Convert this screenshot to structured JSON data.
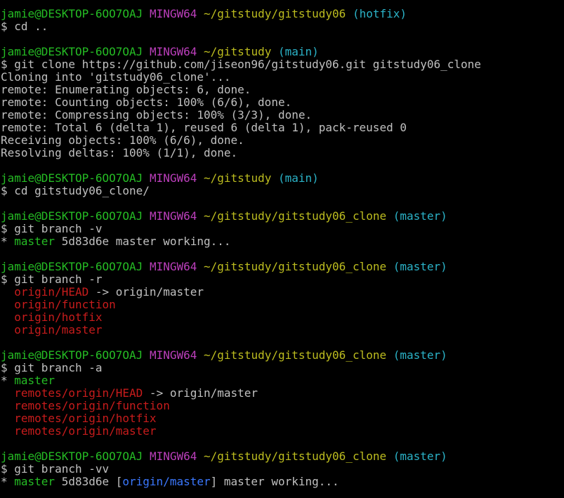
{
  "colors": {
    "background": "#000000",
    "prompt_user": "#25bc24",
    "prompt_system": "#bc3fbc",
    "prompt_path": "#bcbc1f",
    "prompt_branch": "#2bb3c8",
    "output_text": "#c0c0c0",
    "branch_current": "#25bc24",
    "branch_remote": "#c81c1c",
    "branch_upstream": "#3b78ff"
  },
  "lines": [
    [
      {
        "t": "jamie@DESKTOP-6OO7OAJ",
        "c": "user"
      },
      {
        "t": " ",
        "c": "white"
      },
      {
        "t": "MINGW64",
        "c": "mingw"
      },
      {
        "t": " ",
        "c": "white"
      },
      {
        "t": "~/gitstudy/gitstudy06",
        "c": "path"
      },
      {
        "t": " ",
        "c": "white"
      },
      {
        "t": "(hotfix)",
        "c": "branch"
      }
    ],
    [
      {
        "t": "$ cd ..",
        "c": "cmd"
      }
    ],
    [],
    [
      {
        "t": "jamie@DESKTOP-6OO7OAJ",
        "c": "user"
      },
      {
        "t": " ",
        "c": "white"
      },
      {
        "t": "MINGW64",
        "c": "mingw"
      },
      {
        "t": " ",
        "c": "white"
      },
      {
        "t": "~/gitstudy",
        "c": "path"
      },
      {
        "t": " ",
        "c": "white"
      },
      {
        "t": "(main)",
        "c": "branch"
      }
    ],
    [
      {
        "t": "$ git clone https://github.com/jiseon96/gitstudy06.git gitstudy06_clone",
        "c": "cmd"
      }
    ],
    [
      {
        "t": "Cloning into 'gitstudy06_clone'...",
        "c": "out"
      }
    ],
    [
      {
        "t": "remote: Enumerating objects: 6, done.",
        "c": "out"
      }
    ],
    [
      {
        "t": "remote: Counting objects: 100% (6/6), done.",
        "c": "out"
      }
    ],
    [
      {
        "t": "remote: Compressing objects: 100% (3/3), done.",
        "c": "out"
      }
    ],
    [
      {
        "t": "remote: Total 6 (delta 1), reused 6 (delta 1), pack-reused 0",
        "c": "out"
      }
    ],
    [
      {
        "t": "Receiving objects: 100% (6/6), done.",
        "c": "out"
      }
    ],
    [
      {
        "t": "Resolving deltas: 100% (1/1), done.",
        "c": "out"
      }
    ],
    [],
    [
      {
        "t": "jamie@DESKTOP-6OO7OAJ",
        "c": "user"
      },
      {
        "t": " ",
        "c": "white"
      },
      {
        "t": "MINGW64",
        "c": "mingw"
      },
      {
        "t": " ",
        "c": "white"
      },
      {
        "t": "~/gitstudy",
        "c": "path"
      },
      {
        "t": " ",
        "c": "white"
      },
      {
        "t": "(main)",
        "c": "branch"
      }
    ],
    [
      {
        "t": "$ cd gitstudy06_clone/",
        "c": "cmd"
      }
    ],
    [],
    [
      {
        "t": "jamie@DESKTOP-6OO7OAJ",
        "c": "user"
      },
      {
        "t": " ",
        "c": "white"
      },
      {
        "t": "MINGW64",
        "c": "mingw"
      },
      {
        "t": " ",
        "c": "white"
      },
      {
        "t": "~/gitstudy/gitstudy06_clone",
        "c": "path"
      },
      {
        "t": " ",
        "c": "white"
      },
      {
        "t": "(master)",
        "c": "branch"
      }
    ],
    [
      {
        "t": "$ git branch -v",
        "c": "cmd"
      }
    ],
    [
      {
        "t": "* ",
        "c": "white"
      },
      {
        "t": "master",
        "c": "green"
      },
      {
        "t": " 5d83d6e master working...",
        "c": "white"
      }
    ],
    [],
    [
      {
        "t": "jamie@DESKTOP-6OO7OAJ",
        "c": "user"
      },
      {
        "t": " ",
        "c": "white"
      },
      {
        "t": "MINGW64",
        "c": "mingw"
      },
      {
        "t": " ",
        "c": "white"
      },
      {
        "t": "~/gitstudy/gitstudy06_clone",
        "c": "path"
      },
      {
        "t": " ",
        "c": "white"
      },
      {
        "t": "(master)",
        "c": "branch"
      }
    ],
    [
      {
        "t": "$ git branch -r",
        "c": "cmd"
      }
    ],
    [
      {
        "t": "  ",
        "c": "white"
      },
      {
        "t": "origin/HEAD",
        "c": "red"
      },
      {
        "t": " -> origin/master",
        "c": "white"
      }
    ],
    [
      {
        "t": "  ",
        "c": "white"
      },
      {
        "t": "origin/function",
        "c": "red"
      }
    ],
    [
      {
        "t": "  ",
        "c": "white"
      },
      {
        "t": "origin/hotfix",
        "c": "red"
      }
    ],
    [
      {
        "t": "  ",
        "c": "white"
      },
      {
        "t": "origin/master",
        "c": "red"
      }
    ],
    [],
    [
      {
        "t": "jamie@DESKTOP-6OO7OAJ",
        "c": "user"
      },
      {
        "t": " ",
        "c": "white"
      },
      {
        "t": "MINGW64",
        "c": "mingw"
      },
      {
        "t": " ",
        "c": "white"
      },
      {
        "t": "~/gitstudy/gitstudy06_clone",
        "c": "path"
      },
      {
        "t": " ",
        "c": "white"
      },
      {
        "t": "(master)",
        "c": "branch"
      }
    ],
    [
      {
        "t": "$ git branch -a",
        "c": "cmd"
      }
    ],
    [
      {
        "t": "* ",
        "c": "white"
      },
      {
        "t": "master",
        "c": "green"
      }
    ],
    [
      {
        "t": "  ",
        "c": "white"
      },
      {
        "t": "remotes/origin/HEAD",
        "c": "red"
      },
      {
        "t": " -> origin/master",
        "c": "white"
      }
    ],
    [
      {
        "t": "  ",
        "c": "white"
      },
      {
        "t": "remotes/origin/function",
        "c": "red"
      }
    ],
    [
      {
        "t": "  ",
        "c": "white"
      },
      {
        "t": "remotes/origin/hotfix",
        "c": "red"
      }
    ],
    [
      {
        "t": "  ",
        "c": "white"
      },
      {
        "t": "remotes/origin/master",
        "c": "red"
      }
    ],
    [],
    [
      {
        "t": "jamie@DESKTOP-6OO7OAJ",
        "c": "user"
      },
      {
        "t": " ",
        "c": "white"
      },
      {
        "t": "MINGW64",
        "c": "mingw"
      },
      {
        "t": " ",
        "c": "white"
      },
      {
        "t": "~/gitstudy/gitstudy06_clone",
        "c": "path"
      },
      {
        "t": " ",
        "c": "white"
      },
      {
        "t": "(master)",
        "c": "branch"
      }
    ],
    [
      {
        "t": "$ git branch -vv",
        "c": "cmd"
      }
    ],
    [
      {
        "t": "* ",
        "c": "white"
      },
      {
        "t": "master",
        "c": "green"
      },
      {
        "t": " 5d83d6e [",
        "c": "white"
      },
      {
        "t": "origin/master",
        "c": "blue"
      },
      {
        "t": "] master working...",
        "c": "white"
      }
    ]
  ]
}
